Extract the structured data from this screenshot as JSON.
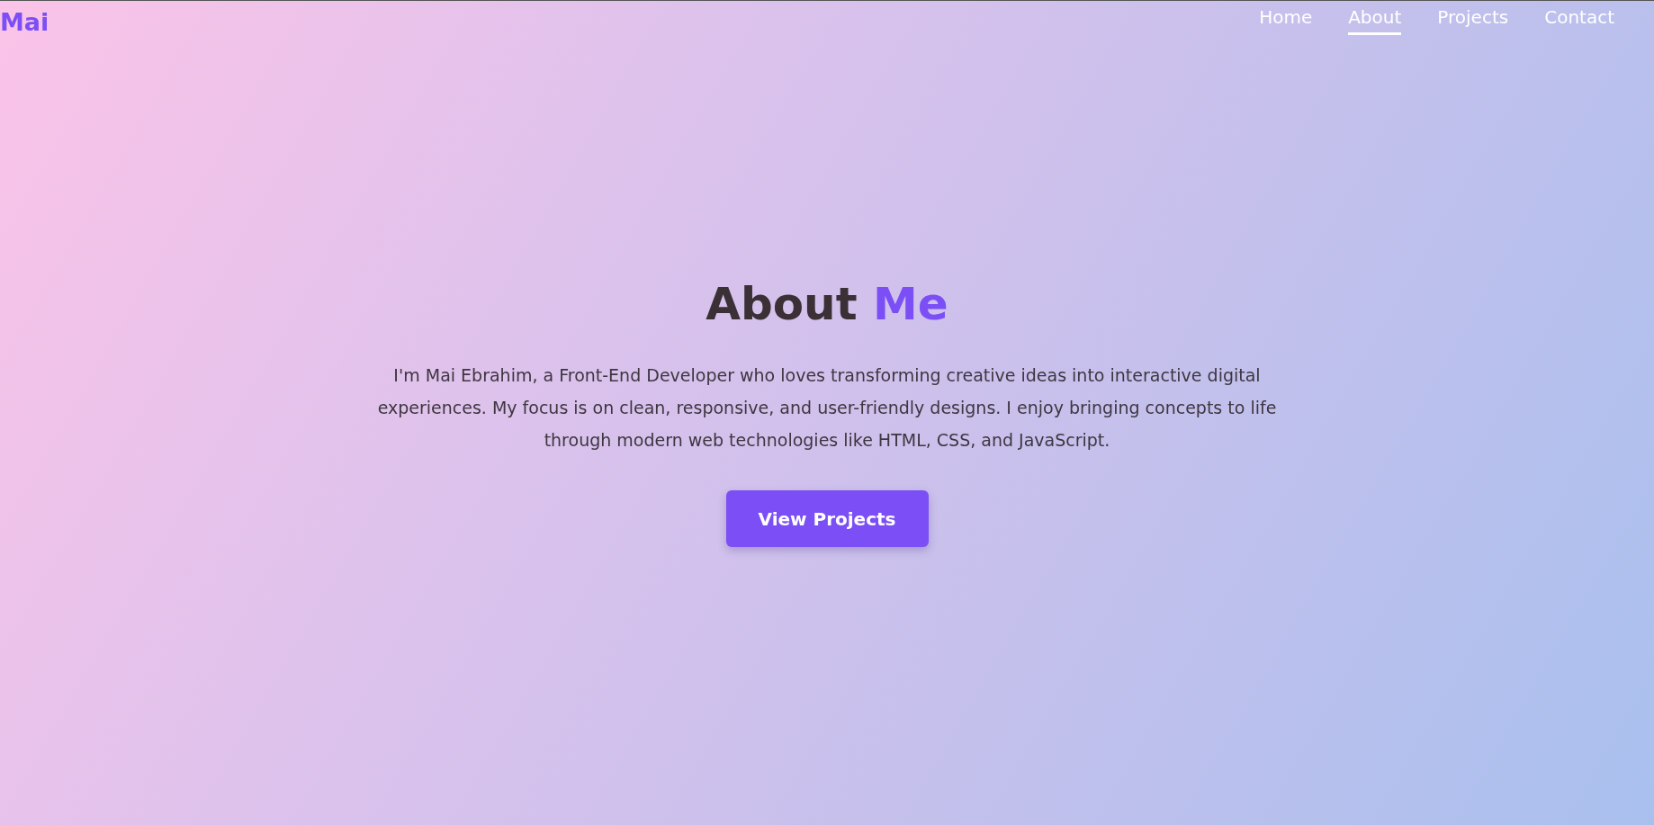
{
  "logo": "Mai",
  "nav": [
    {
      "label": "Home",
      "selected": false
    },
    {
      "label": "About",
      "selected": true
    },
    {
      "label": "Projects",
      "selected": false
    },
    {
      "label": "Contact",
      "selected": false
    }
  ],
  "hero": {
    "title": "About",
    "title_accent": "Me",
    "text": "I'm Mai Ebrahim, a Front-End Developer who loves transforming creative ideas into interactive digital experiences. My focus is on clean, responsive, and user-friendly designs. I enjoy bringing concepts to life through modern web technologies like HTML, CSS, and JavaScript.",
    "button": "View Projects"
  }
}
